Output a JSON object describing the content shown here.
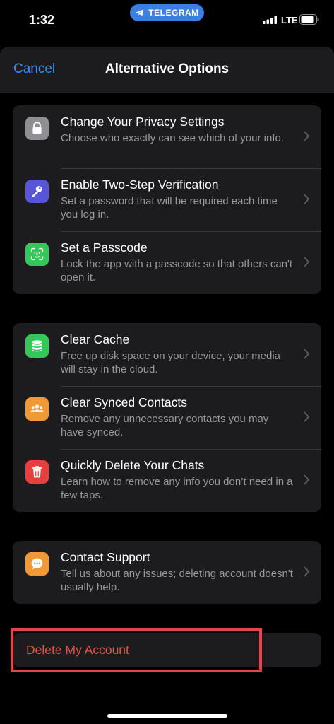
{
  "status_bar": {
    "time": "1:32",
    "app_pill": "TELEGRAM",
    "network": "LTE"
  },
  "nav": {
    "cancel": "Cancel",
    "title": "Alternative Options"
  },
  "group1": [
    {
      "title": "Change Your Privacy Settings",
      "subtitle": "Choose who exactly can see which of your info.",
      "icon": "lock-icon",
      "color": "#8e8e93"
    },
    {
      "title": "Enable Two-Step Verification",
      "subtitle": "Set a password that will be required each time you log in.",
      "icon": "key-icon",
      "color": "#5856d6"
    },
    {
      "title": "Set a Passcode",
      "subtitle": "Lock the app with a passcode so that others can't open it.",
      "icon": "face-id-icon",
      "color": "#34c759"
    }
  ],
  "group2": [
    {
      "title": "Clear Cache",
      "subtitle": "Free up disk space on your device, your media will stay in the cloud.",
      "icon": "database-icon",
      "color": "#34c759"
    },
    {
      "title": "Clear Synced Contacts",
      "subtitle": "Remove any unnecessary contacts you may have synced.",
      "icon": "contacts-icon",
      "color": "#f09a37"
    },
    {
      "title": "Quickly Delete Your Chats",
      "subtitle": "Learn how to remove any info you don’t need in a few taps.",
      "icon": "trash-icon",
      "color": "#e5403f"
    }
  ],
  "group3": [
    {
      "title": "Contact Support",
      "subtitle": "Tell us about any issues; deleting account doesn't usually help.",
      "icon": "chat-bubble-icon",
      "color": "#f09a37"
    }
  ],
  "delete_account": "Delete My Account",
  "colors": {
    "accent": "#3e8bf0",
    "destructive": "#e0564d",
    "highlight_frame": "#e8434a"
  }
}
